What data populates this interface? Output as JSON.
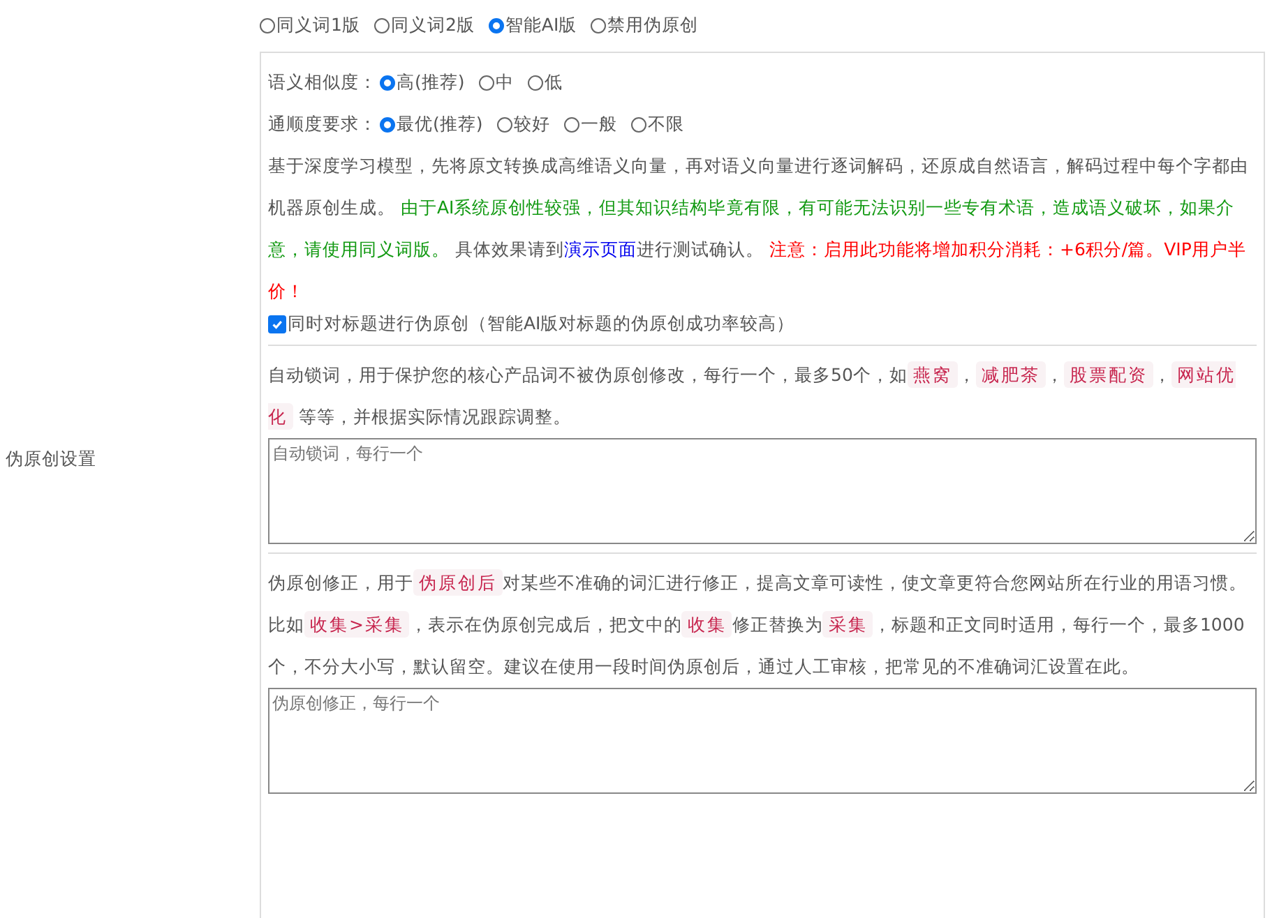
{
  "side_label": "伪原创设置",
  "modes": [
    {
      "label": "同义词1版",
      "selected": false
    },
    {
      "label": "同义词2版",
      "selected": false
    },
    {
      "label": "智能AI版",
      "selected": true
    },
    {
      "label": "禁用伪原创",
      "selected": false
    }
  ],
  "option_groups": [
    {
      "label": "语义相似度：",
      "options": [
        {
          "label": "高(推荐)",
          "selected": true
        },
        {
          "label": "中",
          "selected": false
        },
        {
          "label": "低",
          "selected": false
        }
      ]
    },
    {
      "label": "通顺度要求：",
      "options": [
        {
          "label": "最优(推荐)",
          "selected": true
        },
        {
          "label": "较好",
          "selected": false
        },
        {
          "label": "一般",
          "selected": false
        },
        {
          "label": "不限",
          "selected": false
        }
      ]
    }
  ],
  "ai_description": [
    {
      "kind": "plain",
      "text": "基于深度学习模型，先将原文转换成高维语义向量，再对语义向量进行逐词解码，还原成自然语言，解码过程中每个字都由机器原创生成。 "
    },
    {
      "kind": "green",
      "text": "由于AI系统原创性较强，但其知识结构毕竟有限，有可能无法识别一些专有术语，造成语义破坏，如果介意，请使用同义词版。"
    },
    {
      "kind": "plain",
      "text": " 具体效果请到"
    },
    {
      "kind": "link",
      "text": "演示页面"
    },
    {
      "kind": "plain",
      "text": "进行测试确认。 "
    },
    {
      "kind": "red",
      "text": "注意：启用此功能将增加积分消耗：+6积分/篇。VIP用户半价！"
    }
  ],
  "title_option": {
    "label": "同时对标题进行伪原创（智能AI版对标题的伪原创成功率较高）",
    "checked": true
  },
  "lock_words": {
    "description": [
      {
        "kind": "plain",
        "text": "自动锁词，用于保护您的核心产品词不被伪原创修改，每行一个，最多50个，如"
      },
      {
        "kind": "tag",
        "text": "燕窝"
      },
      {
        "kind": "plain",
        "text": "，"
      },
      {
        "kind": "tag",
        "text": "减肥茶"
      },
      {
        "kind": "plain",
        "text": "，"
      },
      {
        "kind": "tag",
        "text": "股票配资"
      },
      {
        "kind": "plain",
        "text": "，"
      },
      {
        "kind": "tag",
        "text": "网站优化"
      },
      {
        "kind": "plain",
        "text": " 等等，并根据实际情况跟踪调整。"
      }
    ],
    "placeholder": "自动锁词，每行一个"
  },
  "corrections": {
    "description": [
      {
        "kind": "plain",
        "text": "伪原创修正，用于"
      },
      {
        "kind": "tag",
        "text": "伪原创后"
      },
      {
        "kind": "plain",
        "text": "对某些不准确的词汇进行修正，提高文章可读性，使文章更符合您网站所在行业的用语习惯。比如"
      },
      {
        "kind": "tag",
        "text": "收集>采集"
      },
      {
        "kind": "plain",
        "text": "，表示在伪原创完成后，把文中的"
      },
      {
        "kind": "tag",
        "text": "收集"
      },
      {
        "kind": "plain",
        "text": "修正替换为"
      },
      {
        "kind": "tag",
        "text": "采集"
      },
      {
        "kind": "plain",
        "text": "，标题和正文同时适用，每行一个，最多1000个，不分大小写，默认留空。建议在使用一段时间伪原创后，通过人工审核，把常见的不准确词汇设置在此。"
      }
    ],
    "placeholder": "伪原创修正，每行一个"
  }
}
